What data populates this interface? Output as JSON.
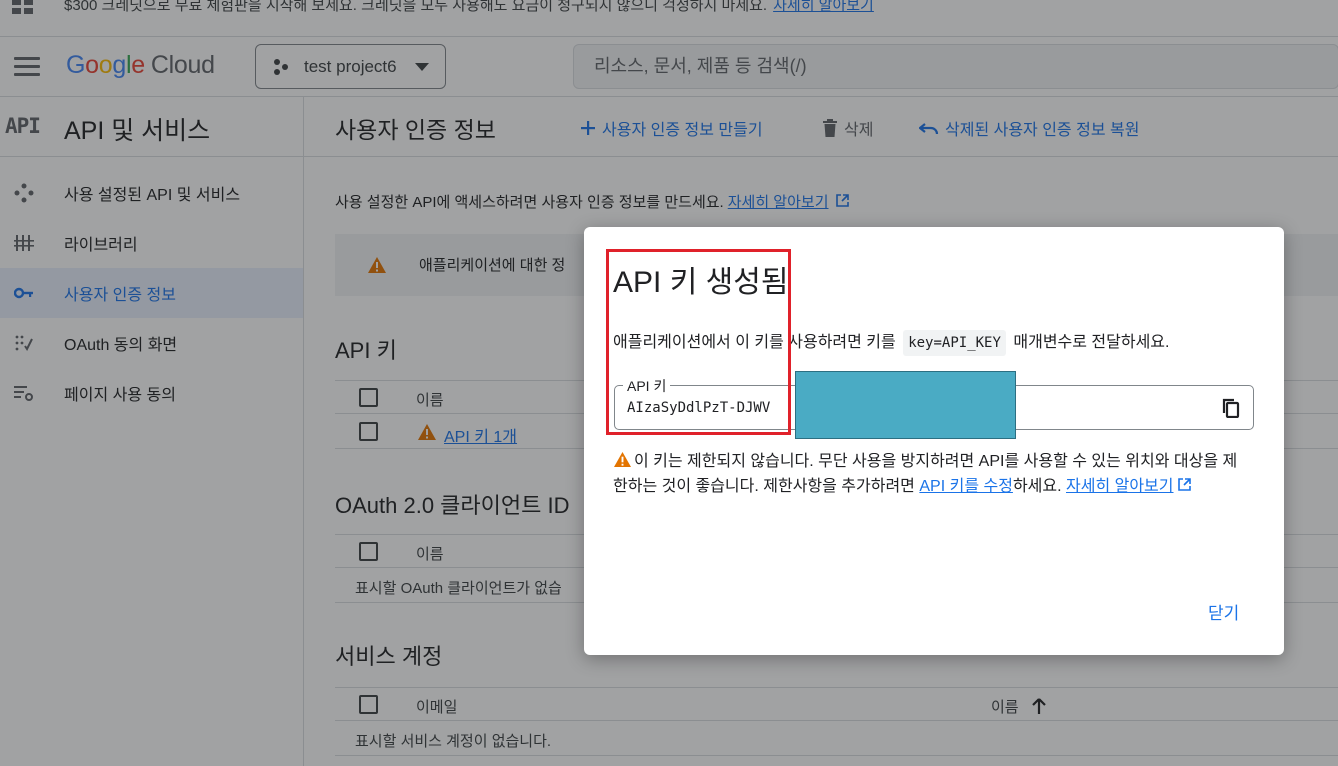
{
  "banner": {
    "text": "$300 크레딧으로 무료 체험판을 시작해 보세요. 크레딧을 모두 사용해도 요금이 청구되지 않으니 걱정하지 마세요.",
    "link": "자세히 알아보기"
  },
  "topbar": {
    "logo_letters": [
      "G",
      "o",
      "o",
      "g",
      "l",
      "e"
    ],
    "logo_cloud": "Cloud",
    "project_name": "test project6",
    "search_placeholder": "리소스, 문서, 제품 등 검색(/)"
  },
  "sidebar": {
    "badge": "API",
    "title": "API 및 서비스",
    "items": [
      {
        "label": "사용 설정된 API 및 서비스",
        "icon": "diamond-dots-icon",
        "active": false
      },
      {
        "label": "라이브러리",
        "icon": "library-icon",
        "active": false
      },
      {
        "label": "사용자 인증 정보",
        "icon": "key-icon",
        "active": true
      },
      {
        "label": "OAuth 동의 화면",
        "icon": "consent-icon",
        "active": false
      },
      {
        "label": "페이지 사용 동의",
        "icon": "settings-list-icon",
        "active": false
      }
    ]
  },
  "content": {
    "title": "사용자 인증 정보",
    "actions": {
      "create": "사용자 인증 정보 만들기",
      "delete": "삭제",
      "restore": "삭제된 사용자 인증 정보 복원"
    },
    "intro": "사용 설정한 API에 액세스하려면 사용자 인증 정보를 만드세요.",
    "intro_link": "자세히 알아보기",
    "warning": "애플리케이션에 대한 정",
    "api_keys": {
      "title": "API 키",
      "col_name": "이름",
      "row_label": "API 키 1개"
    },
    "oauth": {
      "title": "OAuth 2.0 클라이언트 ID",
      "col_name": "이름",
      "empty": "표시할 OAuth 클라이언트가 없습"
    },
    "service_accounts": {
      "title": "서비스 계정",
      "col_email": "이메일",
      "col_name": "이름",
      "empty": "표시할 서비스 계정이 없습니다."
    }
  },
  "dialog": {
    "title": "API 키 생성됨",
    "desc_before": "애플리케이션에서 이 키를 사용하려면 키를",
    "desc_code": "key=API_KEY",
    "desc_after": "매개변수로 전달하세요.",
    "field_label": "API 키",
    "key_value": "AIzaSyDdlPzT-DJWV",
    "warning_text": "이 키는 제한되지 않습니다. 무단 사용을 방지하려면 API를 사용할 수 있는 위치와 대상을 제한하는 것이 좋습니다. 제한사항을 추가하려면",
    "warning_link1": "API 키를 수정",
    "warning_mid": "하세요.",
    "warning_link2": "자세히 알아보기",
    "close_label": "닫기"
  },
  "colors": {
    "accent": "#1a73e8",
    "warning": "#e37400",
    "highlight": "#e0212a",
    "redaction": "#4aabc4"
  }
}
